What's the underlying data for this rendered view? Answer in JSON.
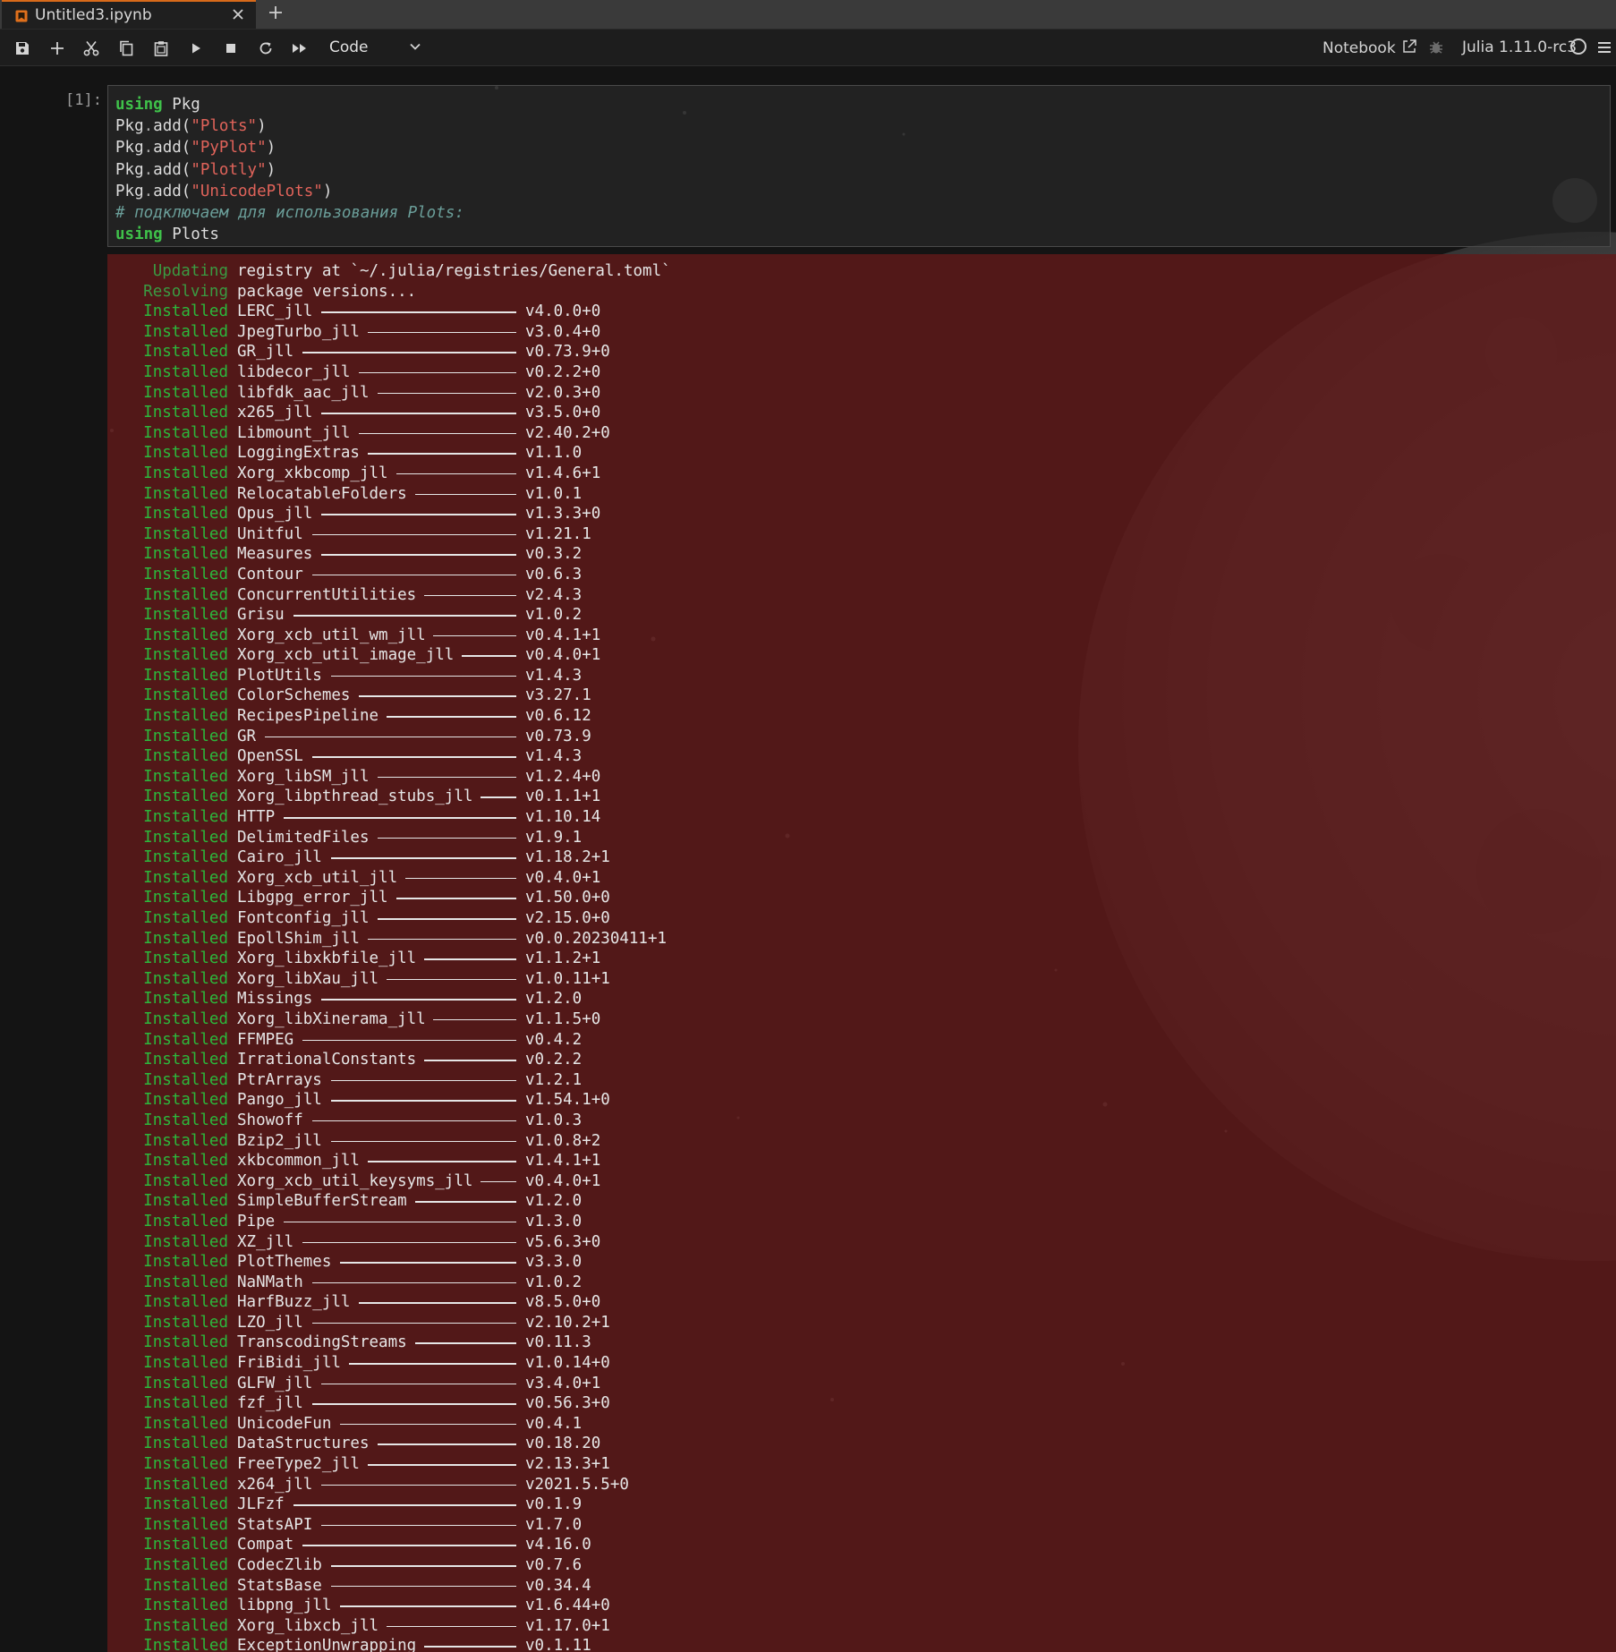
{
  "tab": {
    "title": "Untitled3.ipynb",
    "close_icon": "close-icon",
    "new_tab_icon": "plus-icon"
  },
  "toolbar": {
    "buttons": [
      "save-icon",
      "plus-icon",
      "cut-icon",
      "copy-icon",
      "paste-icon",
      "run-icon",
      "stop-icon",
      "restart-icon",
      "fast-forward-icon"
    ],
    "cell_type": "Code",
    "notebook_label": "Notebook",
    "kernel": "Julia 1.11.0-rc3"
  },
  "colors": {
    "accent": "#d86a1a",
    "keyword": "#3fc14a",
    "string": "#e0635a",
    "comment": "#6b9f9a",
    "output_bg": "#601a1a",
    "output_verb": "#2cb83c"
  },
  "cell": {
    "prompt": "[1]:",
    "code": {
      "line1_kw": "using",
      "line1_rest": " Pkg",
      "line2_obj": "Pkg",
      "line2_fn": "add(",
      "line2_str": "\"Plots\"",
      "line3_str": "\"PyPlot\"",
      "line4_str": "\"Plotly\"",
      "line5_str": "\"UnicodePlots\"",
      "close": ")",
      "comment": "# подключаем для использования Plots:",
      "line7_kw": "using",
      "line7_rest": " Plots"
    }
  },
  "output": {
    "header": [
      {
        "verb": "Updating",
        "text": "registry at `~/.julia/registries/General.toml`"
      },
      {
        "verb": "Resolving",
        "text": "package versions..."
      }
    ],
    "verb": "Installed",
    "packages": [
      {
        "name": "LERC_jll",
        "version": "v4.0.0+0"
      },
      {
        "name": "JpegTurbo_jll",
        "version": "v3.0.4+0"
      },
      {
        "name": "GR_jll",
        "version": "v0.73.9+0"
      },
      {
        "name": "libdecor_jll",
        "version": "v0.2.2+0"
      },
      {
        "name": "libfdk_aac_jll",
        "version": "v2.0.3+0"
      },
      {
        "name": "x265_jll",
        "version": "v3.5.0+0"
      },
      {
        "name": "Libmount_jll",
        "version": "v2.40.2+0"
      },
      {
        "name": "LoggingExtras",
        "version": "v1.1.0"
      },
      {
        "name": "Xorg_xkbcomp_jll",
        "version": "v1.4.6+1"
      },
      {
        "name": "RelocatableFolders",
        "version": "v1.0.1"
      },
      {
        "name": "Opus_jll",
        "version": "v1.3.3+0"
      },
      {
        "name": "Unitful",
        "version": "v1.21.1"
      },
      {
        "name": "Measures",
        "version": "v0.3.2"
      },
      {
        "name": "Contour",
        "version": "v0.6.3"
      },
      {
        "name": "ConcurrentUtilities",
        "version": "v2.4.3"
      },
      {
        "name": "Grisu",
        "version": "v1.0.2"
      },
      {
        "name": "Xorg_xcb_util_wm_jll",
        "version": "v0.4.1+1"
      },
      {
        "name": "Xorg_xcb_util_image_jll",
        "version": "v0.4.0+1"
      },
      {
        "name": "PlotUtils",
        "version": "v1.4.3"
      },
      {
        "name": "ColorSchemes",
        "version": "v3.27.1"
      },
      {
        "name": "RecipesPipeline",
        "version": "v0.6.12"
      },
      {
        "name": "GR",
        "version": "v0.73.9"
      },
      {
        "name": "OpenSSL",
        "version": "v1.4.3"
      },
      {
        "name": "Xorg_libSM_jll",
        "version": "v1.2.4+0"
      },
      {
        "name": "Xorg_libpthread_stubs_jll",
        "version": "v0.1.1+1"
      },
      {
        "name": "HTTP",
        "version": "v1.10.14"
      },
      {
        "name": "DelimitedFiles",
        "version": "v1.9.1"
      },
      {
        "name": "Cairo_jll",
        "version": "v1.18.2+1"
      },
      {
        "name": "Xorg_xcb_util_jll",
        "version": "v0.4.0+1"
      },
      {
        "name": "Libgpg_error_jll",
        "version": "v1.50.0+0"
      },
      {
        "name": "Fontconfig_jll",
        "version": "v2.15.0+0"
      },
      {
        "name": "EpollShim_jll",
        "version": "v0.0.20230411+1"
      },
      {
        "name": "Xorg_libxkbfile_jll",
        "version": "v1.1.2+1"
      },
      {
        "name": "Xorg_libXau_jll",
        "version": "v1.0.11+1"
      },
      {
        "name": "Missings",
        "version": "v1.2.0"
      },
      {
        "name": "Xorg_libXinerama_jll",
        "version": "v1.1.5+0"
      },
      {
        "name": "FFMPEG",
        "version": "v0.4.2"
      },
      {
        "name": "IrrationalConstants",
        "version": "v0.2.2"
      },
      {
        "name": "PtrArrays",
        "version": "v1.2.1"
      },
      {
        "name": "Pango_jll",
        "version": "v1.54.1+0"
      },
      {
        "name": "Showoff",
        "version": "v1.0.3"
      },
      {
        "name": "Bzip2_jll",
        "version": "v1.0.8+2"
      },
      {
        "name": "xkbcommon_jll",
        "version": "v1.4.1+1"
      },
      {
        "name": "Xorg_xcb_util_keysyms_jll",
        "version": "v0.4.0+1"
      },
      {
        "name": "SimpleBufferStream",
        "version": "v1.2.0"
      },
      {
        "name": "Pipe",
        "version": "v1.3.0"
      },
      {
        "name": "XZ_jll",
        "version": "v5.6.3+0"
      },
      {
        "name": "PlotThemes",
        "version": "v3.3.0"
      },
      {
        "name": "NaNMath",
        "version": "v1.0.2"
      },
      {
        "name": "HarfBuzz_jll",
        "version": "v8.5.0+0"
      },
      {
        "name": "LZO_jll",
        "version": "v2.10.2+1"
      },
      {
        "name": "TranscodingStreams",
        "version": "v0.11.3"
      },
      {
        "name": "FriBidi_jll",
        "version": "v1.0.14+0"
      },
      {
        "name": "GLFW_jll",
        "version": "v3.4.0+1"
      },
      {
        "name": "fzf_jll",
        "version": "v0.56.3+0"
      },
      {
        "name": "UnicodeFun",
        "version": "v0.4.1"
      },
      {
        "name": "DataStructures",
        "version": "v0.18.20"
      },
      {
        "name": "FreeType2_jll",
        "version": "v2.13.3+1"
      },
      {
        "name": "x264_jll",
        "version": "v2021.5.5+0"
      },
      {
        "name": "JLFzf",
        "version": "v0.1.9"
      },
      {
        "name": "StatsAPI",
        "version": "v1.7.0"
      },
      {
        "name": "Compat",
        "version": "v4.16.0"
      },
      {
        "name": "CodecZlib",
        "version": "v0.7.6"
      },
      {
        "name": "StatsBase",
        "version": "v0.34.4"
      },
      {
        "name": "libpng_jll",
        "version": "v1.6.44+0"
      },
      {
        "name": "Xorg_libxcb_jll",
        "version": "v1.17.0+1"
      },
      {
        "name": "ExceptionUnwrapping",
        "version": "v0.1.11"
      }
    ]
  }
}
